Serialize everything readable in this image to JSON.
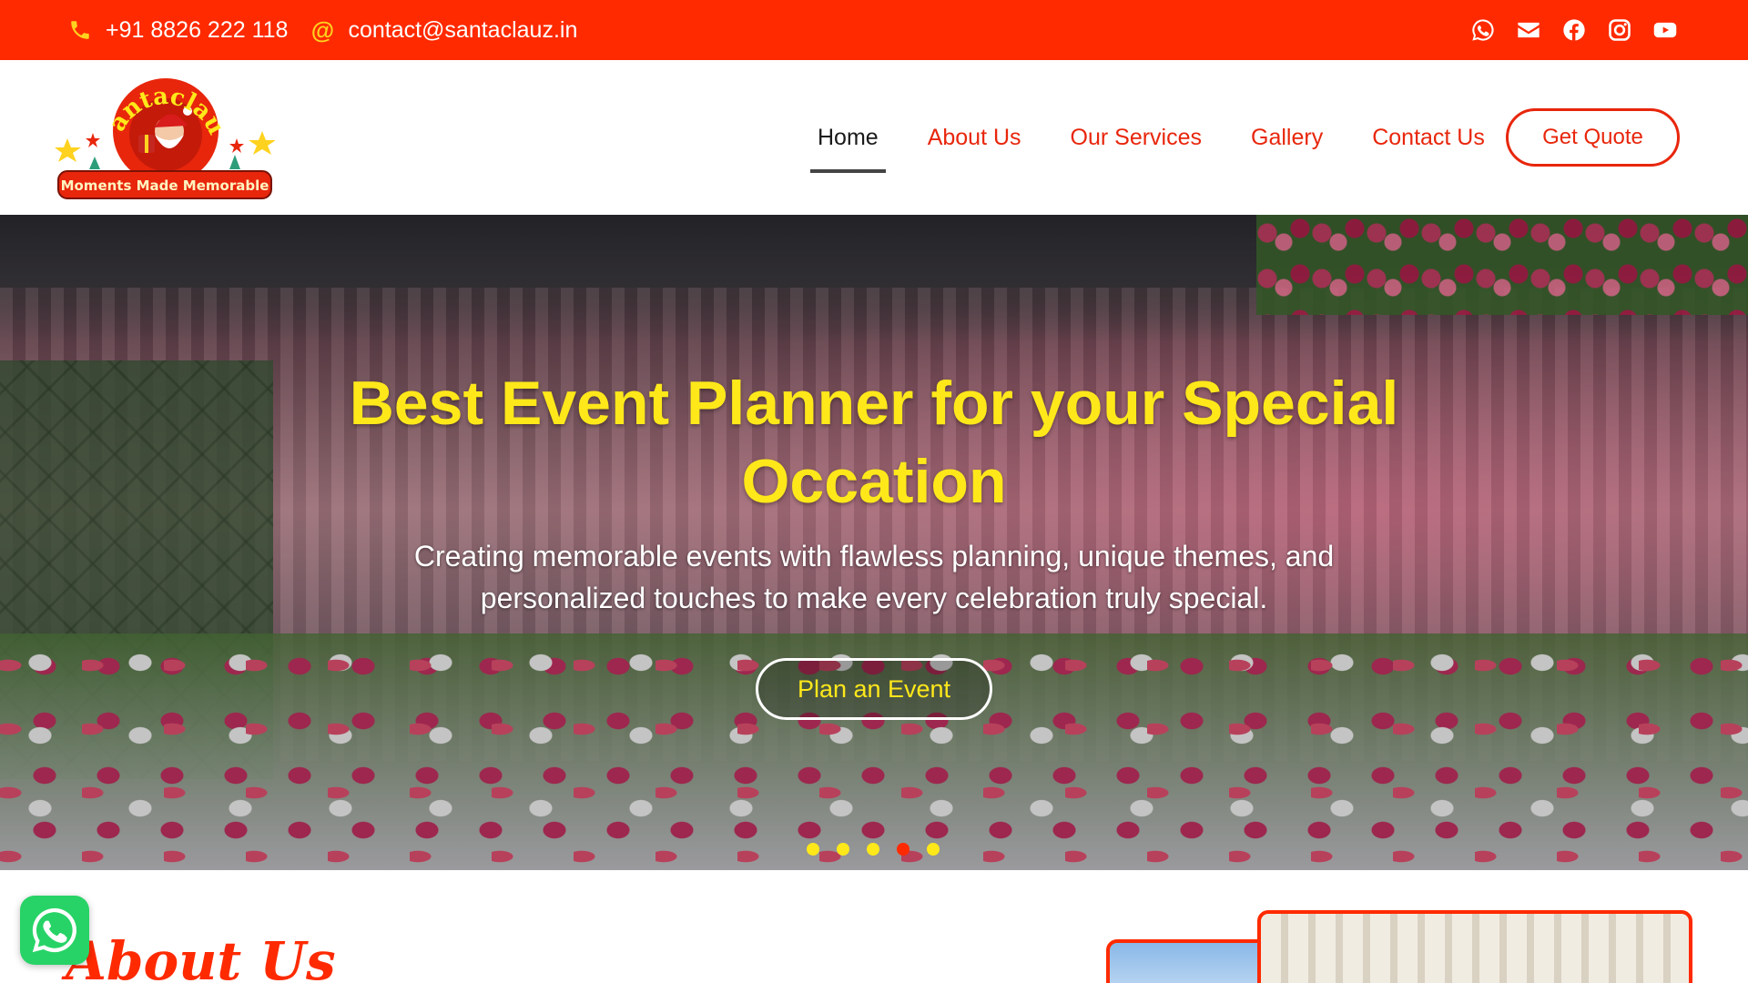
{
  "topbar": {
    "phone": "+91 8826 222 118",
    "email": "contact@santaclauz.in",
    "email_icon_glyph": "@",
    "socials": [
      "whatsapp-icon",
      "mail-icon",
      "facebook-icon",
      "instagram-icon",
      "youtube-icon"
    ],
    "bg_color": "#ff2a00",
    "icon_color": "#ffd21f"
  },
  "logo": {
    "brand": "Santaclauz",
    "tagline": "Moments Made Memorable"
  },
  "nav": {
    "items": [
      {
        "label": "Home",
        "active": true
      },
      {
        "label": "About Us",
        "active": false
      },
      {
        "label": "Our Services",
        "active": false
      },
      {
        "label": "Gallery",
        "active": false
      },
      {
        "label": "Contact Us",
        "active": false
      }
    ],
    "cta": "Get Quote",
    "accent_color": "#e8260c"
  },
  "hero": {
    "title": "Best Event Planner for your Special Occation",
    "subtitle": "Creating memorable events with flawless planning, unique themes, and personalized touches to make every celebration truly special.",
    "button": "Plan an Event",
    "slide_count": 5,
    "active_slide": 4,
    "title_color": "#ffe81a"
  },
  "about": {
    "title": "About Us"
  }
}
